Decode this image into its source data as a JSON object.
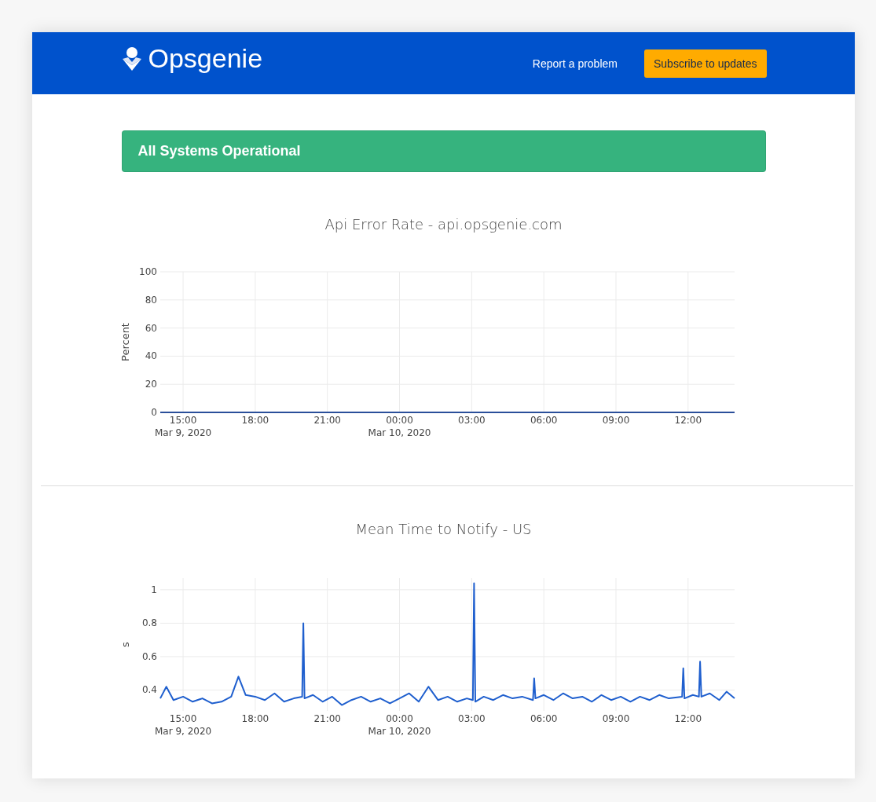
{
  "header": {
    "brand": "Opsgenie",
    "links": [
      {
        "label": "Report a problem",
        "kind": "link"
      },
      {
        "label": "Subscribe to updates",
        "kind": "button"
      }
    ]
  },
  "banner": {
    "text": "All Systems Operational",
    "color": "#36b37e"
  },
  "charts": [
    {
      "title": "Api Error Rate - api.opsgenie.com",
      "chart_data": {
        "type": "line",
        "ylabel": "Percent",
        "grid": true,
        "x": [
          "2020-03-09 14:03",
          "2020-03-09 18:00",
          "2020-03-09 22:00",
          "2020-03-10 02:00",
          "2020-03-10 06:00",
          "2020-03-10 10:00",
          "2020-03-10 13:56"
        ],
        "series": [
          {
            "color": "#2a4f9a",
            "values": [
              0,
              0,
              0,
              0,
              0,
              0,
              0
            ]
          }
        ],
        "xlim": [
          "2020-03-09 14:03",
          "2020-03-10 13:56"
        ],
        "ylim": [
          0,
          100
        ],
        "xticks": [
          {
            "value": "2020-03-09 15:00",
            "label": "15:00 Mar 9, 2020"
          },
          {
            "value": "2020-03-09 18:00",
            "label": "18:00"
          },
          {
            "value": "2020-03-09 21:00",
            "label": "21:00"
          },
          {
            "value": "2020-03-10 00:00",
            "label": "00:00 Mar 10, 2020"
          },
          {
            "value": "2020-03-10 03:00",
            "label": "03:00"
          },
          {
            "value": "2020-03-10 06:00",
            "label": "06:00"
          },
          {
            "value": "2020-03-10 09:00",
            "label": "09:00"
          },
          {
            "value": "2020-03-10 12:00",
            "label": "12:00"
          }
        ],
        "yticks": [
          0,
          20,
          40,
          60,
          80,
          100
        ]
      }
    },
    {
      "title": "Mean Time to Notify - US",
      "chart_data": {
        "type": "line",
        "ylabel": "s",
        "grid": true,
        "x": [
          "2020-03-09 14:03",
          "2020-03-09 14:18",
          "2020-03-09 14:36",
          "2020-03-09 15:00",
          "2020-03-09 15:24",
          "2020-03-09 15:48",
          "2020-03-09 16:12",
          "2020-03-09 16:36",
          "2020-03-09 17:00",
          "2020-03-09 17:18",
          "2020-03-09 17:36",
          "2020-03-09 18:00",
          "2020-03-09 18:24",
          "2020-03-09 18:48",
          "2020-03-09 19:12",
          "2020-03-09 19:36",
          "2020-03-09 19:57",
          "2020-03-09 20:00",
          "2020-03-09 20:03",
          "2020-03-09 20:24",
          "2020-03-09 20:48",
          "2020-03-09 21:12",
          "2020-03-09 21:36",
          "2020-03-09 22:00",
          "2020-03-09 22:24",
          "2020-03-09 22:48",
          "2020-03-09 23:12",
          "2020-03-09 23:36",
          "2020-03-10 00:00",
          "2020-03-10 00:24",
          "2020-03-10 00:48",
          "2020-03-10 01:12",
          "2020-03-10 01:36",
          "2020-03-10 02:00",
          "2020-03-10 02:24",
          "2020-03-10 02:48",
          "2020-03-10 03:03",
          "2020-03-10 03:06",
          "2020-03-10 03:09",
          "2020-03-10 03:30",
          "2020-03-10 03:54",
          "2020-03-10 04:18",
          "2020-03-10 04:42",
          "2020-03-10 05:06",
          "2020-03-10 05:33",
          "2020-03-10 05:36",
          "2020-03-10 05:39",
          "2020-03-10 06:00",
          "2020-03-10 06:24",
          "2020-03-10 06:48",
          "2020-03-10 07:12",
          "2020-03-10 07:36",
          "2020-03-10 08:00",
          "2020-03-10 08:24",
          "2020-03-10 08:48",
          "2020-03-10 09:12",
          "2020-03-10 09:36",
          "2020-03-10 10:00",
          "2020-03-10 10:24",
          "2020-03-10 10:48",
          "2020-03-10 11:12",
          "2020-03-10 11:45",
          "2020-03-10 11:48",
          "2020-03-10 11:51",
          "2020-03-10 12:12",
          "2020-03-10 12:27",
          "2020-03-10 12:30",
          "2020-03-10 12:33",
          "2020-03-10 12:54",
          "2020-03-10 13:18",
          "2020-03-10 13:36",
          "2020-03-10 13:56"
        ],
        "series": [
          {
            "color": "#1f5fce",
            "values": [
              0.35,
              0.42,
              0.34,
              0.36,
              0.33,
              0.35,
              0.32,
              0.33,
              0.36,
              0.48,
              0.37,
              0.36,
              0.34,
              0.38,
              0.33,
              0.35,
              0.36,
              0.8,
              0.35,
              0.37,
              0.33,
              0.36,
              0.31,
              0.34,
              0.36,
              0.33,
              0.35,
              0.32,
              0.35,
              0.38,
              0.33,
              0.42,
              0.34,
              0.36,
              0.33,
              0.35,
              0.34,
              1.04,
              0.33,
              0.36,
              0.34,
              0.37,
              0.35,
              0.36,
              0.34,
              0.47,
              0.35,
              0.37,
              0.34,
              0.38,
              0.35,
              0.36,
              0.33,
              0.37,
              0.34,
              0.36,
              0.33,
              0.36,
              0.34,
              0.37,
              0.35,
              0.36,
              0.53,
              0.35,
              0.37,
              0.36,
              0.57,
              0.36,
              0.38,
              0.34,
              0.39,
              0.35
            ]
          }
        ],
        "xlim": [
          "2020-03-09 14:03",
          "2020-03-10 13:56"
        ],
        "ylim": [
          0.275,
          1.07
        ],
        "xticks": [
          {
            "value": "2020-03-09 15:00",
            "label": "15:00 Mar 9, 2020"
          },
          {
            "value": "2020-03-09 18:00",
            "label": "18:00"
          },
          {
            "value": "2020-03-09 21:00",
            "label": "21:00"
          },
          {
            "value": "2020-03-10 00:00",
            "label": "00:00 Mar 10, 2020"
          },
          {
            "value": "2020-03-10 03:00",
            "label": "03:00"
          },
          {
            "value": "2020-03-10 06:00",
            "label": "06:00"
          },
          {
            "value": "2020-03-10 09:00",
            "label": "09:00"
          },
          {
            "value": "2020-03-10 12:00",
            "label": "12:00"
          }
        ],
        "yticks": [
          0.4,
          0.6,
          0.8,
          {
            "value": 1,
            "label": "1"
          }
        ]
      }
    }
  ]
}
